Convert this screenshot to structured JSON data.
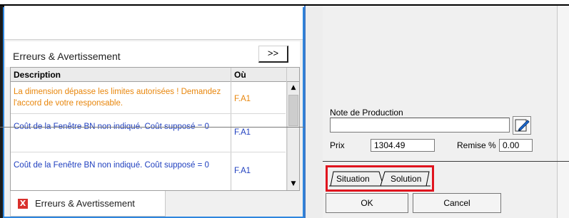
{
  "errors_panel": {
    "title": "Erreurs & Avertissement",
    "expand_label": ">>",
    "columns": {
      "description": "Description",
      "where": "Où"
    },
    "rows": [
      {
        "description": "La dimension dépasse les limites autorisées ! Demandez l'accord de votre responsable.",
        "where": "F.A1",
        "severity": "warning",
        "color": "#e8860c"
      },
      {
        "description": "Coût de la Fenêtre BN non indiqué. Coût supposé = 0",
        "where": "F.A1",
        "severity": "info",
        "color": "#1f3fbf"
      },
      {
        "description": "Coût de la Fenêtre BN non indiqué. Coût supposé = 0",
        "where": "F.A1",
        "severity": "info",
        "color": "#1f3fbf"
      }
    ],
    "bottom_tab": {
      "icon": "error-x-icon",
      "label": "Erreurs & Avertissement"
    }
  },
  "form": {
    "note_label": "Note de Production",
    "note_value": "",
    "edit_icon": "edit-pencil-icon",
    "prix_label": "Prix",
    "prix_value": "1304.49",
    "remise_label": "Remise %",
    "remise_value": "0.00",
    "tabs": [
      {
        "label": "Situation"
      },
      {
        "label": "Solution"
      }
    ],
    "ok_label": "OK",
    "cancel_label": "Cancel"
  },
  "colors": {
    "highlight_box": "#e0141e",
    "panel_border": "#2e86de",
    "accent_orange": "#e8860c",
    "accent_blue": "#1f3fbf"
  }
}
